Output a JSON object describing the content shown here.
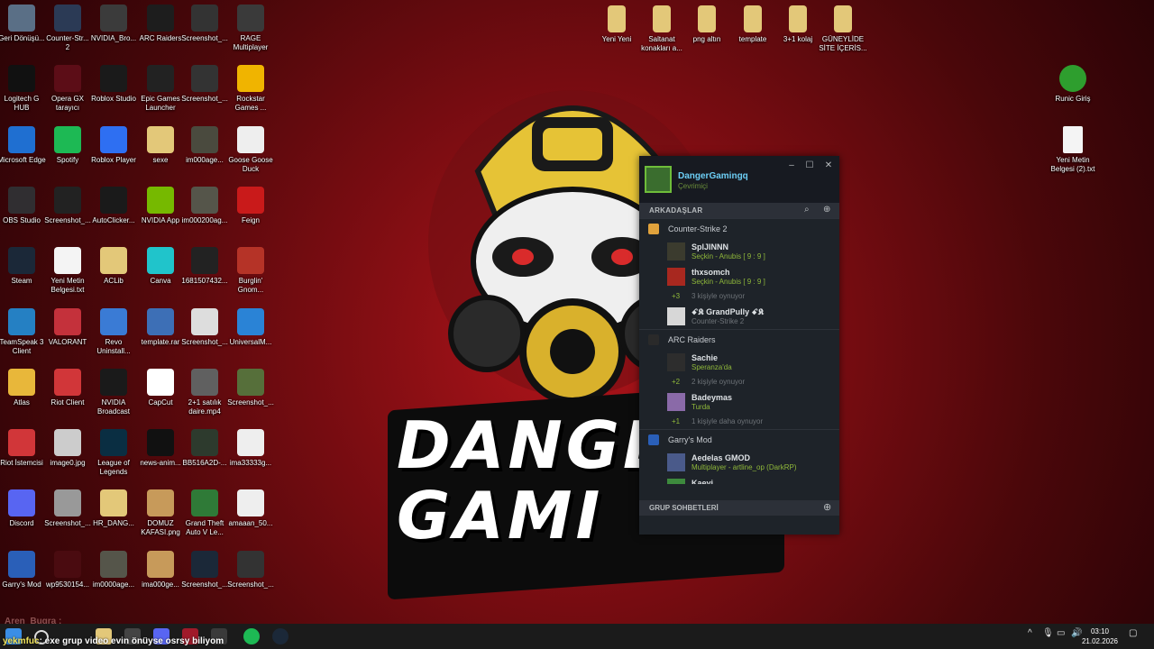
{
  "desktop_icons": [
    {
      "label": "Geri Dönüşü...",
      "icon": "recycle-bin-icon",
      "color": "#5a6f86"
    },
    {
      "label": "Counter-Str... 2",
      "icon": "cs2-icon",
      "color": "#2b3a55"
    },
    {
      "label": "NVIDIA_Bro...",
      "icon": "nvidia-broadcast-icon",
      "color": "#3b3b3b"
    },
    {
      "label": "ARC Raiders",
      "icon": "arc-raiders-icon",
      "color": "#1d1d1d"
    },
    {
      "label": "Screenshot_...",
      "icon": "screenshot-icon",
      "color": "#333"
    },
    {
      "label": "RAGE Multiplayer",
      "icon": "rage-icon",
      "color": "#3a3a3a"
    },
    {
      "label": "Logitech G HUB",
      "icon": "logitech-icon",
      "color": "#111"
    },
    {
      "label": "Opera GX tarayıcı",
      "icon": "opera-gx-icon",
      "color": "#5c0d17"
    },
    {
      "label": "Roblox Studio",
      "icon": "roblox-studio-icon",
      "color": "#1a1a1a"
    },
    {
      "label": "Epic Games Launcher",
      "icon": "epic-games-icon",
      "color": "#222"
    },
    {
      "label": "Screenshot_...",
      "icon": "screenshot-icon",
      "color": "#333"
    },
    {
      "label": "Rockstar Games ...",
      "icon": "rockstar-icon",
      "color": "#f0b400"
    },
    {
      "label": "Microsoft Edge",
      "icon": "edge-icon",
      "color": "#1f6fd1"
    },
    {
      "label": "Spotify",
      "icon": "spotify-icon",
      "color": "#1db954"
    },
    {
      "label": "Roblox Player",
      "icon": "roblox-player-icon",
      "color": "#2e6ff2"
    },
    {
      "label": "sexe",
      "icon": "folder-zip-icon",
      "color": "#e3c879"
    },
    {
      "label": "im000age...",
      "icon": "image-icon",
      "color": "#4a4a3e"
    },
    {
      "label": "Goose Goose Duck",
      "icon": "goose-icon",
      "color": "#eeeeee"
    },
    {
      "label": "OBS Studio",
      "icon": "obs-icon",
      "color": "#302e31"
    },
    {
      "label": "Screenshot_...",
      "icon": "screenshot-icon",
      "color": "#222"
    },
    {
      "label": "AutoClicker...",
      "icon": "autoclicker-icon",
      "color": "#1a1a1a"
    },
    {
      "label": "NVIDIA App",
      "icon": "nvidia-app-icon",
      "color": "#76b900"
    },
    {
      "label": "im000200ag...",
      "icon": "image-icon",
      "color": "#55554a"
    },
    {
      "label": "Feign",
      "icon": "feign-icon",
      "color": "#c91a1a"
    },
    {
      "label": "Steam",
      "icon": "steam-icon",
      "color": "#1b2838"
    },
    {
      "label": "Yeni Metin Belgesi.txt",
      "icon": "text-file-icon",
      "color": "#f4f4f4"
    },
    {
      "label": "ACLib",
      "icon": "folder-zip-icon",
      "color": "#e3c879"
    },
    {
      "label": "Canva",
      "icon": "canva-icon",
      "color": "#20c4cb"
    },
    {
      "label": "1681507432...",
      "icon": "image-icon",
      "color": "#222"
    },
    {
      "label": "Burglin' Gnom...",
      "icon": "burglin-icon",
      "color": "#b53327"
    },
    {
      "label": "TeamSpeak 3 Client",
      "icon": "teamspeak-icon",
      "color": "#2580c3"
    },
    {
      "label": "VALORANT",
      "icon": "valorant-icon",
      "color": "#c4313b"
    },
    {
      "label": "Revo Uninstall...",
      "icon": "revo-icon",
      "color": "#3a7bd5"
    },
    {
      "label": "template.rar",
      "icon": "rar-icon",
      "color": "#3d6fb6"
    },
    {
      "label": "Screenshot_...",
      "icon": "screenshot-icon",
      "color": "#ddd"
    },
    {
      "label": "UniversalM...",
      "icon": "folder-icon",
      "color": "#2a83d6"
    },
    {
      "label": "Atlas",
      "icon": "folder-icon",
      "color": "#e8b73a"
    },
    {
      "label": "Riot Client",
      "icon": "riot-client-icon",
      "color": "#d13639"
    },
    {
      "label": "NVIDIA Broadcast",
      "icon": "nvidia-broadcast-icon",
      "color": "#1a1a1a"
    },
    {
      "label": "CapCut",
      "icon": "capcut-icon",
      "color": "#ffffff"
    },
    {
      "label": "2+1 satılık daire.mp4",
      "icon": "video-icon",
      "color": "#606060"
    },
    {
      "label": "Screenshot_...",
      "icon": "screenshot-icon",
      "color": "#566f3a"
    },
    {
      "label": "Riot İstemcisi",
      "icon": "riot-client-icon",
      "color": "#d13639"
    },
    {
      "label": "image0.jpg",
      "icon": "image-icon",
      "color": "#cccccc"
    },
    {
      "label": "League of Legends",
      "icon": "lol-icon",
      "color": "#0a2e42"
    },
    {
      "label": "news-anim...",
      "icon": "image-icon",
      "color": "#111"
    },
    {
      "label": "BB516A2D-...",
      "icon": "image-icon",
      "color": "#2d3a2d"
    },
    {
      "label": "ima33333g...",
      "icon": "image-icon",
      "color": "#eeeeee"
    },
    {
      "label": "Discord",
      "icon": "discord-icon",
      "color": "#5865f2"
    },
    {
      "label": "Screenshot_...",
      "icon": "screenshot-icon",
      "color": "#999"
    },
    {
      "label": "HR_DANG...",
      "icon": "folder-zip-icon",
      "color": "#e3c879"
    },
    {
      "label": "DOMUZ KAFASI.png",
      "icon": "image-icon",
      "color": "#c79a5a"
    },
    {
      "label": "Grand Theft Auto V Le...",
      "icon": "gta-icon",
      "color": "#2f7a37"
    },
    {
      "label": "amaaan_50...",
      "icon": "image-icon",
      "color": "#eeeeee"
    },
    {
      "label": "Garry's Mod",
      "icon": "garrys-mod-icon",
      "color": "#2a5fb8"
    },
    {
      "label": "wp9530154...",
      "icon": "image-icon",
      "color": "#4a0b10"
    },
    {
      "label": "im0000age...",
      "icon": "image-icon",
      "color": "#55554a"
    },
    {
      "label": "ima000ge...",
      "icon": "image-icon",
      "color": "#c79a5a"
    },
    {
      "label": "Screenshot_...",
      "icon": "screenshot-icon",
      "color": "#1b2838"
    },
    {
      "label": "Screenshot_...",
      "icon": "screenshot-icon",
      "color": "#333"
    }
  ],
  "desktop_icons_top": [
    {
      "label": "Yeni Yeni",
      "icon": "folder-zip-icon"
    },
    {
      "label": "Saltanat konakları a...",
      "icon": "folder-zip-icon"
    },
    {
      "label": "png altın",
      "icon": "folder-zip-icon"
    },
    {
      "label": "template",
      "icon": "folder-zip-icon"
    },
    {
      "label": "3+1 kolaj",
      "icon": "folder-zip-icon"
    },
    {
      "label": "GÜNEYLİDE SİTE İÇERİS...",
      "icon": "folder-zip-icon"
    }
  ],
  "desktop_icons_right": [
    {
      "label": "Runic Giriş",
      "icon": "tree-icon"
    },
    {
      "label": "Yeni Metin Belgesi (2).txt",
      "icon": "text-file-icon"
    }
  ],
  "wallpaper": {
    "line1": "DANGE",
    "line2": "GAMI"
  },
  "steam": {
    "username": "DangerGamingq",
    "status": "Çevrimiçi",
    "friends_header": "ARKADAŞLAR",
    "group_chats_header": "GRUP SOHBETLERİ",
    "groups": [
      {
        "name": "Counter-Strike 2",
        "icon_color": "#e0a23c",
        "friends": [
          {
            "name": "SplJINNN",
            "sub": "Seçkin - Anubis [ 9 : 9 ]",
            "avatar_color": "#3b3b2e"
          },
          {
            "name": "thxsomch",
            "sub": "Seçkin - Anubis [ 9 : 9 ]",
            "avatar_color": "#a8281f"
          }
        ],
        "more_count": "+3",
        "more_text": "3 kişiyle oynuyor",
        "extra": {
          "name": "ꗃ𝕶 GrandPully ꗃ𝕶",
          "sub": "Counter-Strike 2",
          "avatar_color": "#d7d7d7"
        }
      },
      {
        "name": "ARC Raiders",
        "icon_color": "#2a2a2a",
        "friends": [
          {
            "name": "Sachie",
            "sub": "Speranza'da",
            "avatar_color": "#2d2d2d"
          }
        ],
        "more_count": "+2",
        "more_text": "2 kişiyle oynuyor",
        "extra": {
          "name": "Badeymas",
          "sub": "Turda",
          "avatar_color": "#8a6aa8"
        },
        "extra_more_count": "+1",
        "extra_more_text": "1 kişiyle daha oynuyor"
      },
      {
        "name": "Garry's Mod",
        "icon_color": "#2a5fb8",
        "friends": [
          {
            "name": "Aedelas GMOD",
            "sub": "Multiplayer - artline_op (DarkRP)",
            "avatar_color": "#4a5a8a"
          }
        ],
        "partial": {
          "name": "Kaeyi",
          "avatar_color": "#3d8a3d"
        }
      }
    ]
  },
  "overlay_chat": {
    "user_top": "Aren_Bugra :",
    "user": "yekmfuc",
    "message": ": exe grup video evin önüyse osrsy biliyom"
  },
  "taskbar": {
    "time": "03:10",
    "date": "21.02.2026"
  }
}
